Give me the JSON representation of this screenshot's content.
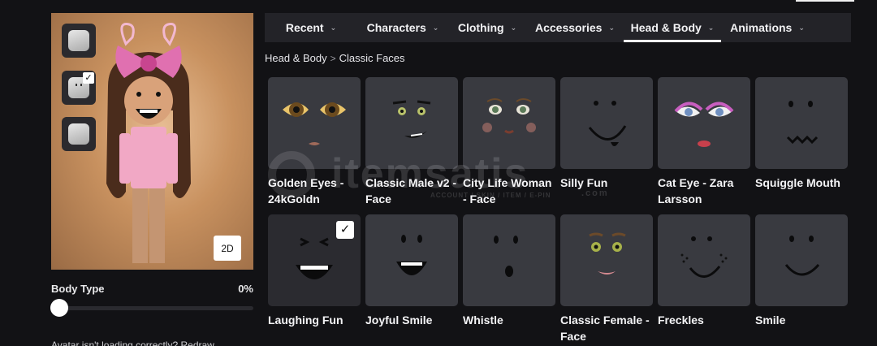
{
  "preview": {
    "thumbnails": [
      {
        "name": "head-thumbnail-plain",
        "checked": false
      },
      {
        "name": "head-thumbnail-face",
        "checked": true
      },
      {
        "name": "head-thumbnail-alt",
        "checked": false
      }
    ],
    "checkmark": "✓",
    "view_toggle": "2D"
  },
  "body_type": {
    "label": "Body Type",
    "value": "0%",
    "level": 0
  },
  "hint_text": "Avatar isn't loading correctly? Redraw",
  "tabs": [
    {
      "label": "Recent",
      "chevron": "⌄"
    },
    {
      "label": "Characters",
      "chevron": "⌄"
    },
    {
      "label": "Clothing",
      "chevron": "⌄"
    },
    {
      "label": "Accessories",
      "chevron": "⌄"
    },
    {
      "label": "Head & Body",
      "chevron": "⌄",
      "active": true
    },
    {
      "label": "Animations",
      "chevron": "⌄"
    }
  ],
  "breadcrumb": {
    "parent": "Head & Body",
    "separator": ">",
    "current": "Classic Faces"
  },
  "items": [
    {
      "name": "Golden Eyes - 24kGoldn",
      "face": "golden-eyes"
    },
    {
      "name": "Classic Male v2 - Face",
      "face": "classic-male"
    },
    {
      "name": "City Life Woman - Face",
      "face": "city-life-woman"
    },
    {
      "name": "Silly Fun",
      "face": "silly-fun"
    },
    {
      "name": "Cat Eye - Zara Larsson",
      "face": "cat-eye"
    },
    {
      "name": "Squiggle Mouth",
      "face": "squiggle-mouth"
    },
    {
      "name": "Laughing Fun",
      "face": "laughing-fun",
      "selected": true
    },
    {
      "name": "Joyful Smile",
      "face": "joyful-smile"
    },
    {
      "name": "Whistle",
      "face": "whistle"
    },
    {
      "name": "Classic Female - Face",
      "face": "classic-female"
    },
    {
      "name": "Freckles",
      "face": "freckles"
    },
    {
      "name": "Smile",
      "face": "smile"
    }
  ],
  "watermark": {
    "text": "itemsatis",
    "sub": "ACCOUNT / SKIN / ITEM / E-PIN",
    "domain": ".com"
  },
  "colors": {
    "background": "#121215",
    "tile": "#393a40",
    "tab_bar": "#232328",
    "accent": "#ffffff"
  }
}
